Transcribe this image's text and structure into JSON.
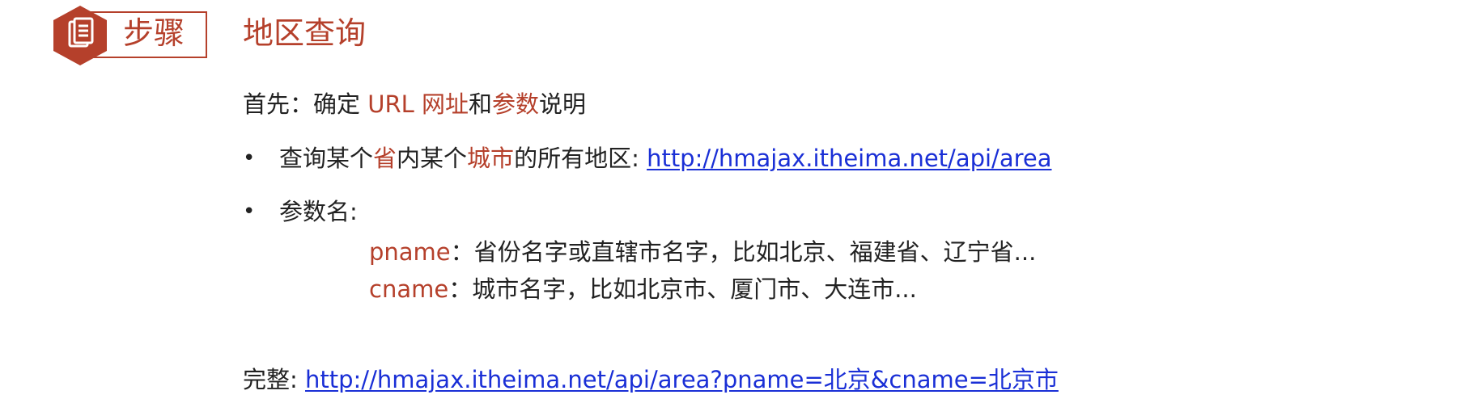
{
  "badge": {
    "label": "步骤",
    "icon": "document-icon",
    "color": "#b5402b"
  },
  "title": "地区查询",
  "intro": {
    "prefix": "首先：确定 ",
    "url_word": "URL 网址",
    "and": "和",
    "params_word": "参数",
    "suffix": "说明"
  },
  "bullets": {
    "marker": "•",
    "area": {
      "text1": "查询某个",
      "hl1": "省",
      "text2": "内某个",
      "hl2": "城市",
      "text3": "的所有地区: ",
      "url": "http://hmajax.itheima.net/api/area"
    },
    "params": {
      "label": "参数名:",
      "items": [
        {
          "name": "pname",
          "desc": "：省份名字或直辖市名字，比如北京、福建省、辽宁省..."
        },
        {
          "name": "cname",
          "desc": "：城市名字，比如北京市、厦门市、大连市..."
        }
      ]
    }
  },
  "full": {
    "label": "完整: ",
    "url": "http://hmajax.itheima.net/api/area?pname=北京&cname=北京市"
  },
  "colors": {
    "accent": "#b5402b",
    "link": "#1a2fd6",
    "text": "#222222"
  }
}
